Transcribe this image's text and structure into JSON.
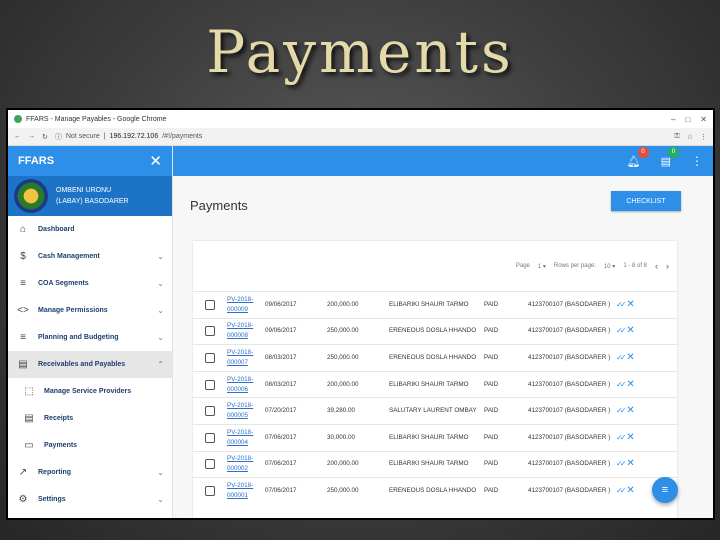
{
  "slide_title": "Payments",
  "browser": {
    "window_title": "FFARS - Manage Payables - Google Chrome",
    "security": "Not secure",
    "url_host": "196.192.72.106",
    "url_path": "/#!/payments"
  },
  "sidebar": {
    "brand": "FFARS",
    "user_name": "OMBENI URONU (LABAY) BASODARER",
    "items": [
      {
        "label": "Dashboard",
        "icon": "home-icon",
        "glyph": "⌂",
        "chevron": ""
      },
      {
        "label": "Cash Management",
        "icon": "dollar-icon",
        "glyph": "$",
        "chevron": "⌄"
      },
      {
        "label": "COA Segments",
        "icon": "list-icon",
        "glyph": "≡",
        "chevron": "⌄"
      },
      {
        "label": "Manage Permissions",
        "icon": "code-icon",
        "glyph": "<>",
        "chevron": "⌄"
      },
      {
        "label": "Planning and Budgeting",
        "icon": "list-icon",
        "glyph": "≡",
        "chevron": "⌄"
      },
      {
        "label": "Receivables and Payables",
        "icon": "document-icon",
        "glyph": "▤",
        "chevron": "⌃"
      },
      {
        "label": "Manage Service Providers",
        "icon": "dashed-square-icon",
        "glyph": "⬚",
        "chevron": ""
      },
      {
        "label": "Receipts",
        "icon": "receipt-icon",
        "glyph": "▤",
        "chevron": ""
      },
      {
        "label": "Payments",
        "icon": "credit-card-icon",
        "glyph": "▭",
        "chevron": ""
      },
      {
        "label": "Reporting",
        "icon": "trend-icon",
        "glyph": "↗",
        "chevron": "⌄"
      },
      {
        "label": "Settings",
        "icon": "gear-icon",
        "glyph": "⚙",
        "chevron": "⌄"
      }
    ]
  },
  "topbar": {
    "notifications_count": "0",
    "messages_count": "0"
  },
  "main": {
    "title": "Payments",
    "checklist_label": "CHECKLIST",
    "pager": {
      "page_label": "Page",
      "page_value": "1",
      "rows_label": "Rows per page:",
      "rows_value": "10",
      "range": "1 - 8 of 8"
    },
    "rows": [
      {
        "pv": "PV-2018-000009",
        "date": "09/06/2017",
        "amount": "200,000.00",
        "name": "ELIBARIKI SHAURI TARMO",
        "status": "PAID",
        "account": "4123700107 (BASODARER )"
      },
      {
        "pv": "PV-2018-000008",
        "date": "09/06/2017",
        "amount": "250,000.00",
        "name": "ERENEOUS DOSLA HHANDO",
        "status": "PAID",
        "account": "4123700107 (BASODARER )"
      },
      {
        "pv": "PV-2018-000007",
        "date": "08/03/2017",
        "amount": "250,000.00",
        "name": "ERENEOUS DOSLA HHANDO",
        "status": "PAID",
        "account": "4123700107 (BASODARER )"
      },
      {
        "pv": "PV-2018-000006",
        "date": "08/03/2017",
        "amount": "200,000.00",
        "name": "ELIBARIKI SHAURI TARMO",
        "status": "PAID",
        "account": "4123700107 (BASODARER )"
      },
      {
        "pv": "PV-2018-000005",
        "date": "07/20/2017",
        "amount": "39,280.00",
        "name": "SALUTARY LAURENT OMBAY",
        "status": "PAID",
        "account": "4123700107 (BASODARER )"
      },
      {
        "pv": "PV-2018-000004",
        "date": "07/06/2017",
        "amount": "30,000.00",
        "name": "ELIBARIKI SHAURI TARMO",
        "status": "PAID",
        "account": "4123700107 (BASODARER )"
      },
      {
        "pv": "PV-2018-000002",
        "date": "07/06/2017",
        "amount": "200,000.00",
        "name": "ELIBARIKI SHAURI TARMO",
        "status": "PAID",
        "account": "4123700107 (BASODARER )"
      },
      {
        "pv": "PV-2018-000001",
        "date": "07/06/2017",
        "amount": "250,000.00",
        "name": "ERENEOUS DOSLA HHANDO",
        "status": "PAID",
        "account": "4123700107 (BASODARER )"
      }
    ]
  },
  "colors": {
    "primary": "#2d8fe8",
    "profile_bg": "#1d74c7",
    "title_gold": "#e3d9a9"
  }
}
